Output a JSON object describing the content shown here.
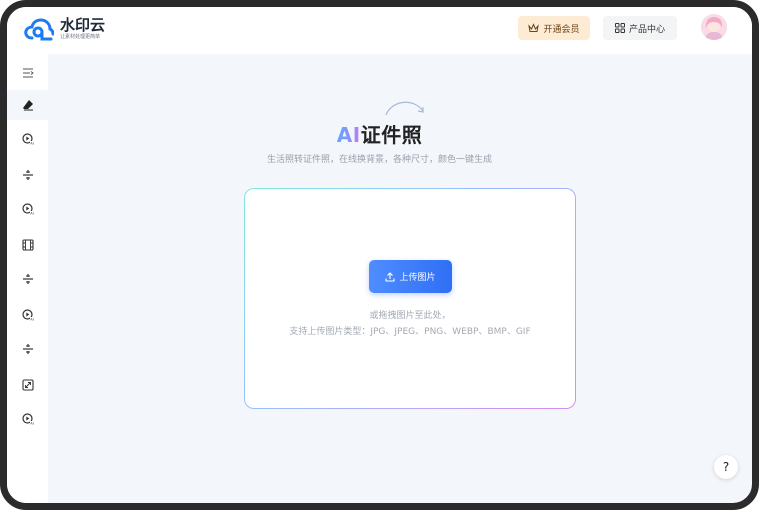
{
  "brand": {
    "name": "水印云",
    "tagline": "让素材处理更简单",
    "color": "#1e7cf2"
  },
  "header": {
    "vip_label": "开通会员",
    "products_label": "产品中心"
  },
  "sidebar": {
    "items": [
      {
        "icon": "collapse-menu-icon"
      },
      {
        "icon": "eraser-icon",
        "active": true
      },
      {
        "icon": "ai-video-icon"
      },
      {
        "icon": "split-icon"
      },
      {
        "icon": "ai-video-icon"
      },
      {
        "icon": "film-icon"
      },
      {
        "icon": "split-icon"
      },
      {
        "icon": "ai-video-icon"
      },
      {
        "icon": "split-icon"
      },
      {
        "icon": "expand-icon"
      },
      {
        "icon": "ai-video-icon"
      }
    ]
  },
  "main": {
    "title_prefix": "AI",
    "title": "证件照",
    "subtitle": "生活照转证件照，在线换背景，各种尺寸，颜色一键生成",
    "upload_button": "上传图片",
    "hint_line1": "或拖拽图片至此处，",
    "hint_line2": "支持上传图片类型：JPG、JPEG、PNG、WEBP、BMP、GIF"
  },
  "help": {
    "label": "?"
  },
  "colors": {
    "accent": "#2f6ff5",
    "vip_bg": "#fdebd4",
    "page_bg": "#f3f6fb"
  }
}
